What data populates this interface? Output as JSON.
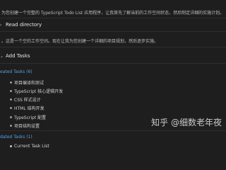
{
  "intro": {
    "line": "为您创建一个完整的 TypeScript Todo List 应用程序，让我首先了解当前的工作空间状态，然后制定详细的实施计划。"
  },
  "read_directory": {
    "label": "Read directory",
    "description": "。这是一个空的工作空间。现在让我为您创建一个详细的项目规划，然后逐步实施。"
  },
  "add_tasks": {
    "label": "Add Tasks"
  },
  "created_tasks": {
    "header": "eated Tasks (6)",
    "items": [
      "项目编译和测试",
      "TypeScript 核心逻辑开发",
      "CSS 样式设计",
      "HTML 结构开发",
      "TypeScript 配置",
      "项目结构设置"
    ]
  },
  "updated_tasks": {
    "header": "dated Tasks (1)",
    "items": [
      "Current Task List"
    ]
  },
  "watermark": {
    "text": "知乎 @细数老年夜"
  },
  "colors": {
    "background": "#1e1e1e",
    "group_header": "#4fa3e3",
    "text": "#cccccc"
  }
}
